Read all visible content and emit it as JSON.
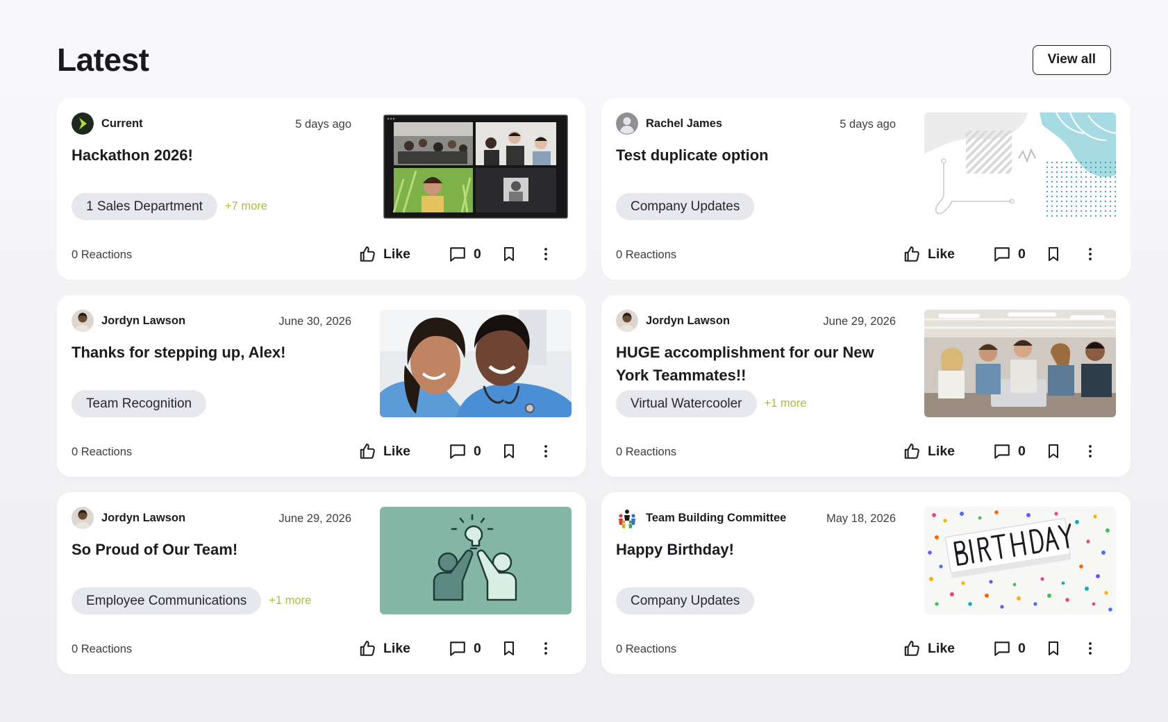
{
  "header": {
    "title": "Latest",
    "view_all": "View all"
  },
  "colors": {
    "accent_more": "#a3c23c",
    "tag_bg": "#e7e7ee",
    "card_bg": "#ffffff"
  },
  "posts": [
    {
      "author": "Current",
      "date": "5 days ago",
      "title": "Hackathon 2026!",
      "tag": "1 Sales Department",
      "more": "+7 more",
      "reactions": "0 Reactions",
      "like_label": "Like",
      "comments": "0",
      "avatar_icon": "current-logo-icon",
      "thumbnail": "video-call-image"
    },
    {
      "author": "Rachel James",
      "date": "5 days ago",
      "title": "Test duplicate option",
      "tag": "Company Updates",
      "more": "",
      "reactions": "0 Reactions",
      "like_label": "Like",
      "comments": "0",
      "avatar_icon": "user-placeholder-icon",
      "thumbnail": "abstract-pattern-image"
    },
    {
      "author": "Jordyn Lawson",
      "date": "June 30, 2026",
      "title": "Thanks for stepping up, Alex!",
      "tag": "Team Recognition",
      "more": "",
      "reactions": "0 Reactions",
      "like_label": "Like",
      "comments": "0",
      "avatar_icon": "user-photo-icon",
      "thumbnail": "nurses-photo-image"
    },
    {
      "author": "Jordyn Lawson",
      "date": "June 29, 2026",
      "title": "HUGE accomplishment for our New York Teammates!!",
      "tag": "Virtual Watercooler",
      "more": "+1 more",
      "reactions": "0 Reactions",
      "like_label": "Like",
      "comments": "0",
      "avatar_icon": "user-photo-icon",
      "thumbnail": "office-team-image"
    },
    {
      "author": "Jordyn Lawson",
      "date": "June 29, 2026",
      "title": "So Proud of Our Team!",
      "tag": "Employee Communications",
      "more": "+1 more",
      "reactions": "0 Reactions",
      "like_label": "Like",
      "comments": "0",
      "avatar_icon": "user-photo-icon",
      "thumbnail": "high-five-illustration-image"
    },
    {
      "author": "Team Building Committee",
      "date": "May 18, 2026",
      "title": "Happy Birthday!",
      "tag": "Company Updates",
      "more": "",
      "reactions": "0 Reactions",
      "like_label": "Like",
      "comments": "0",
      "avatar_icon": "team-group-icon",
      "thumbnail": "birthday-confetti-image"
    }
  ]
}
